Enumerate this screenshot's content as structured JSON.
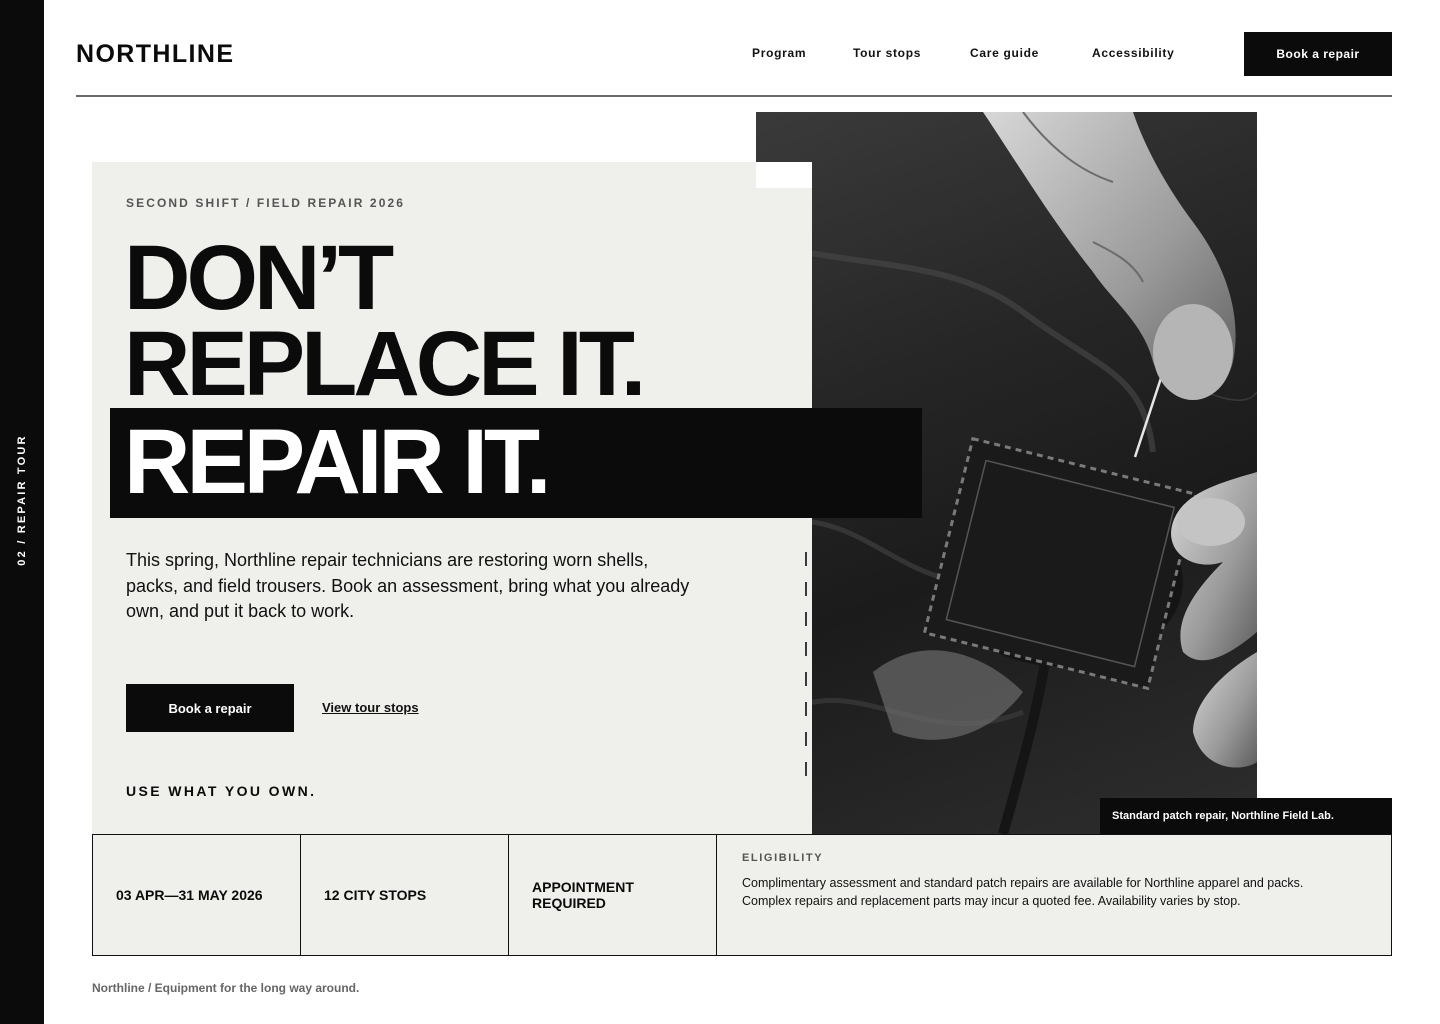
{
  "rail": {
    "label": "02 / REPAIR TOUR"
  },
  "header": {
    "logo": "NORTHLINE",
    "nav": [
      "Program",
      "Tour stops",
      "Care guide",
      "Accessibility"
    ],
    "cta": "Book a repair"
  },
  "hero": {
    "eyebrow": "SECOND SHIFT / FIELD REPAIR 2026",
    "headline_1": "DON’T",
    "headline_2": "REPLACE IT.",
    "headline_3": "REPAIR IT.",
    "lead": "This spring, Northline repair technicians are restoring worn shells, packs, and field trousers. Book an assessment, bring what you already own, and put it back to work.",
    "primary_cta": "Book a repair",
    "secondary_cta": "View tour stops",
    "tagline": "USE WHAT YOU OWN."
  },
  "photo": {
    "subject": "hands stitching a patch on worn black jacket",
    "caption": "Standard patch repair, Northline Field Lab."
  },
  "strip": {
    "dates": "03 APR—31 MAY 2026",
    "stops": "12 CITY STOPS",
    "appointment_1": "APPOINTMENT",
    "appointment_2": "REQUIRED",
    "eligibility_title": "ELIGIBILITY",
    "eligibility_line_1": "Complimentary assessment and standard patch repairs are available for Northline apparel and packs.",
    "eligibility_line_2": "Complex repairs and replacement parts may incur a quoted fee. Availability varies by stop."
  },
  "footer": {
    "text": "Northline / Equipment for the long way around."
  },
  "colors": {
    "ink": "#0b0b0b",
    "panel": "#efefeb",
    "muted": "#555555"
  }
}
